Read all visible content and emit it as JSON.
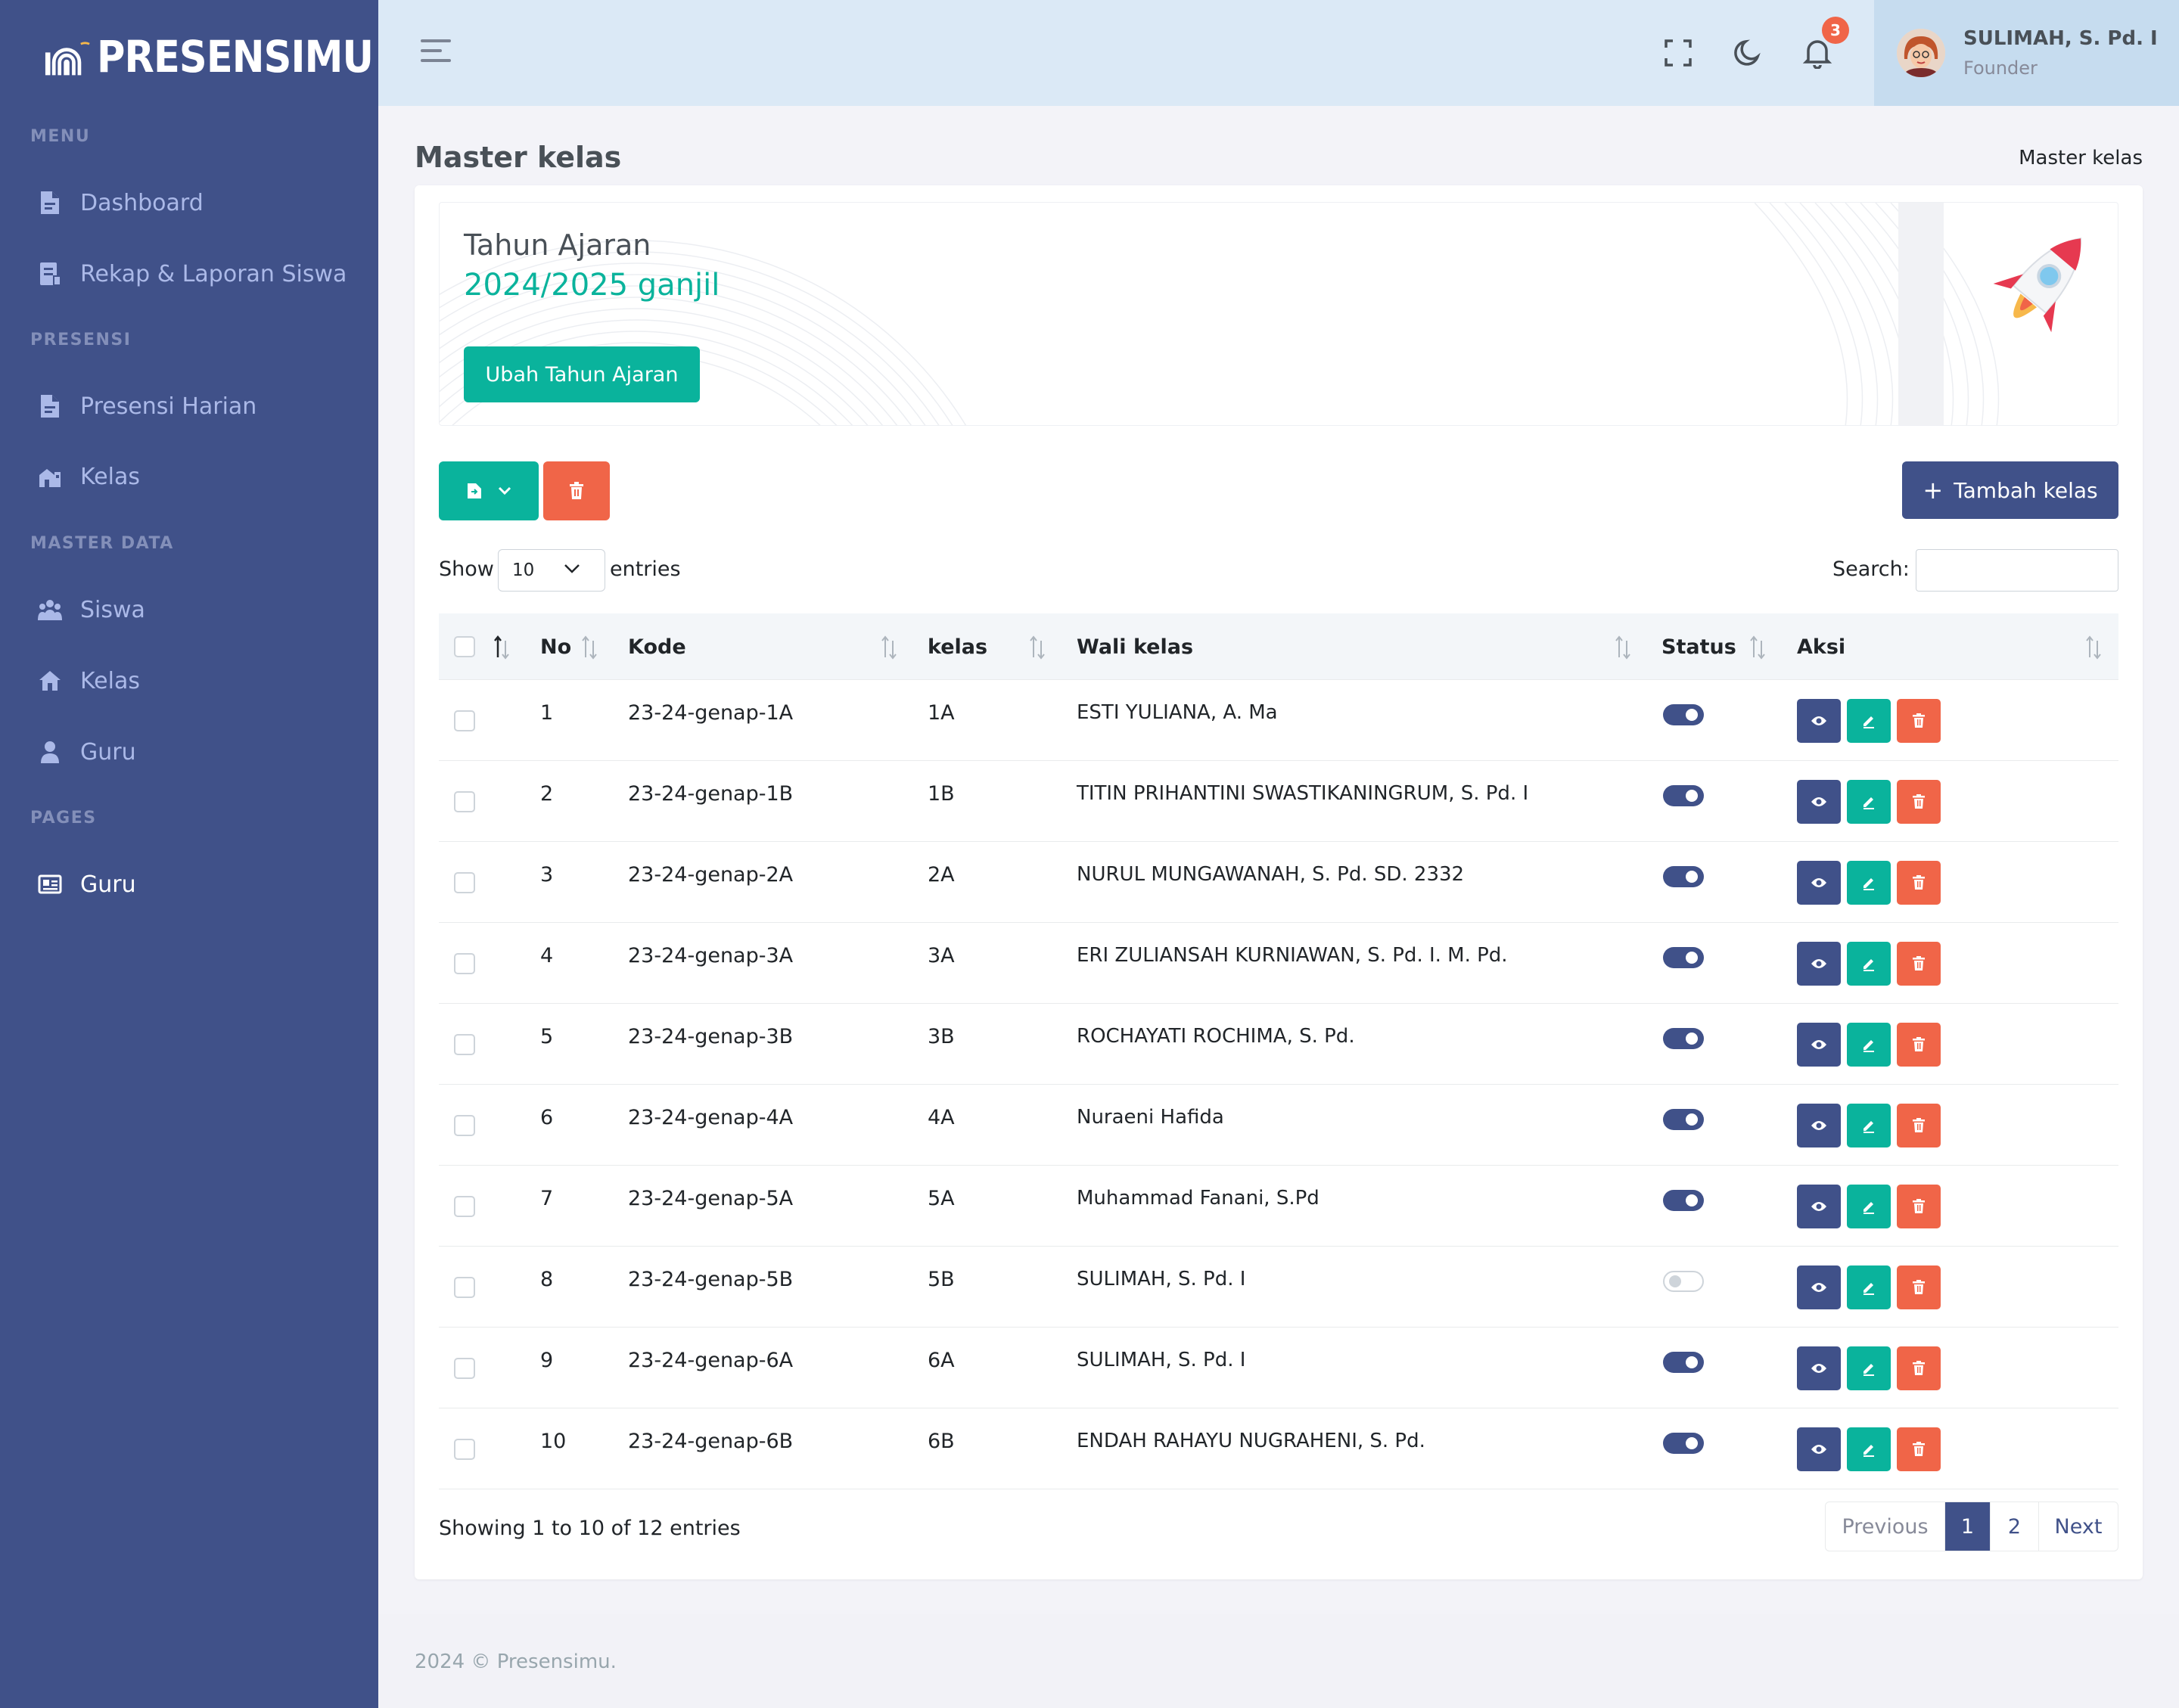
{
  "brand": {
    "name": "PRESENSIMU"
  },
  "sidebar": {
    "sections": [
      {
        "title": "MENU"
      },
      {
        "title": "PRESENSI"
      },
      {
        "title": "MASTER DATA"
      },
      {
        "title": "PAGES"
      }
    ],
    "items": [
      {
        "label": "Dashboard",
        "icon": "file-icon"
      },
      {
        "label": "Rekap & Laporan Siswa",
        "icon": "report-icon"
      },
      {
        "label": "Presensi Harian",
        "icon": "file-icon"
      },
      {
        "label": "Kelas",
        "icon": "building-icon"
      },
      {
        "label": "Siswa",
        "icon": "users-icon"
      },
      {
        "label": "Kelas",
        "icon": "home-icon"
      },
      {
        "label": "Guru",
        "icon": "user-icon"
      },
      {
        "label": "Guru",
        "icon": "id-card-icon"
      }
    ]
  },
  "topbar": {
    "notif_count": "3",
    "user_name": "SULIMAH, S. Pd. I",
    "user_role": "Founder"
  },
  "page": {
    "title": "Master kelas",
    "breadcrumb": "Master kelas"
  },
  "banner": {
    "title": "Tahun Ajaran",
    "year": "2024/2025 ganjil",
    "button": "Ubah Tahun Ajaran"
  },
  "toolbar": {
    "add_label": "Tambah kelas",
    "add_symbol": "+"
  },
  "table_controls": {
    "show": "Show",
    "page_size": "10",
    "entries": "entries",
    "search": "Search:"
  },
  "table": {
    "headers": [
      "No",
      "Kode",
      "kelas",
      "Wali kelas",
      "Status",
      "Aksi"
    ],
    "rows": [
      {
        "no": "1",
        "kode": "23-24-genap-1A",
        "kelas": "1A",
        "wali": "ESTI YULIANA, A. Ma",
        "status": true
      },
      {
        "no": "2",
        "kode": "23-24-genap-1B",
        "kelas": "1B",
        "wali": "TITIN PRIHANTINI SWASTIKANINGRUM, S. Pd. I",
        "status": true
      },
      {
        "no": "3",
        "kode": "23-24-genap-2A",
        "kelas": "2A",
        "wali": "NURUL MUNGAWANAH, S. Pd. SD. 2332",
        "status": true
      },
      {
        "no": "4",
        "kode": "23-24-genap-3A",
        "kelas": "3A",
        "wali": "ERI ZULIANSAH KURNIAWAN, S. Pd. I. M. Pd.",
        "status": true
      },
      {
        "no": "5",
        "kode": "23-24-genap-3B",
        "kelas": "3B",
        "wali": "ROCHAYATI ROCHIMA, S. Pd.",
        "status": true
      },
      {
        "no": "6",
        "kode": "23-24-genap-4A",
        "kelas": "4A",
        "wali": "Nuraeni Hafida",
        "status": true
      },
      {
        "no": "7",
        "kode": "23-24-genap-5A",
        "kelas": "5A",
        "wali": "Muhammad Fanani, S.Pd",
        "status": true
      },
      {
        "no": "8",
        "kode": "23-24-genap-5B",
        "kelas": "5B",
        "wali": "SULIMAH, S. Pd. I",
        "status": false
      },
      {
        "no": "9",
        "kode": "23-24-genap-6A",
        "kelas": "6A",
        "wali": "SULIMAH, S. Pd. I",
        "status": true
      },
      {
        "no": "10",
        "kode": "23-24-genap-6B",
        "kelas": "6B",
        "wali": "ENDAH RAHAYU NUGRAHENI, S. Pd.",
        "status": true
      }
    ]
  },
  "pagination": {
    "info": "Showing 1 to 10 of 12 entries",
    "prev": "Previous",
    "pages": [
      "1",
      "2"
    ],
    "next": "Next",
    "current": "1"
  },
  "footer": {
    "text": "2024 © Presensimu."
  },
  "colors": {
    "primary": "#405189",
    "success": "#0ab39c",
    "danger": "#f06548",
    "sidebar": "#405189",
    "topbar": "#dbe9f6"
  }
}
